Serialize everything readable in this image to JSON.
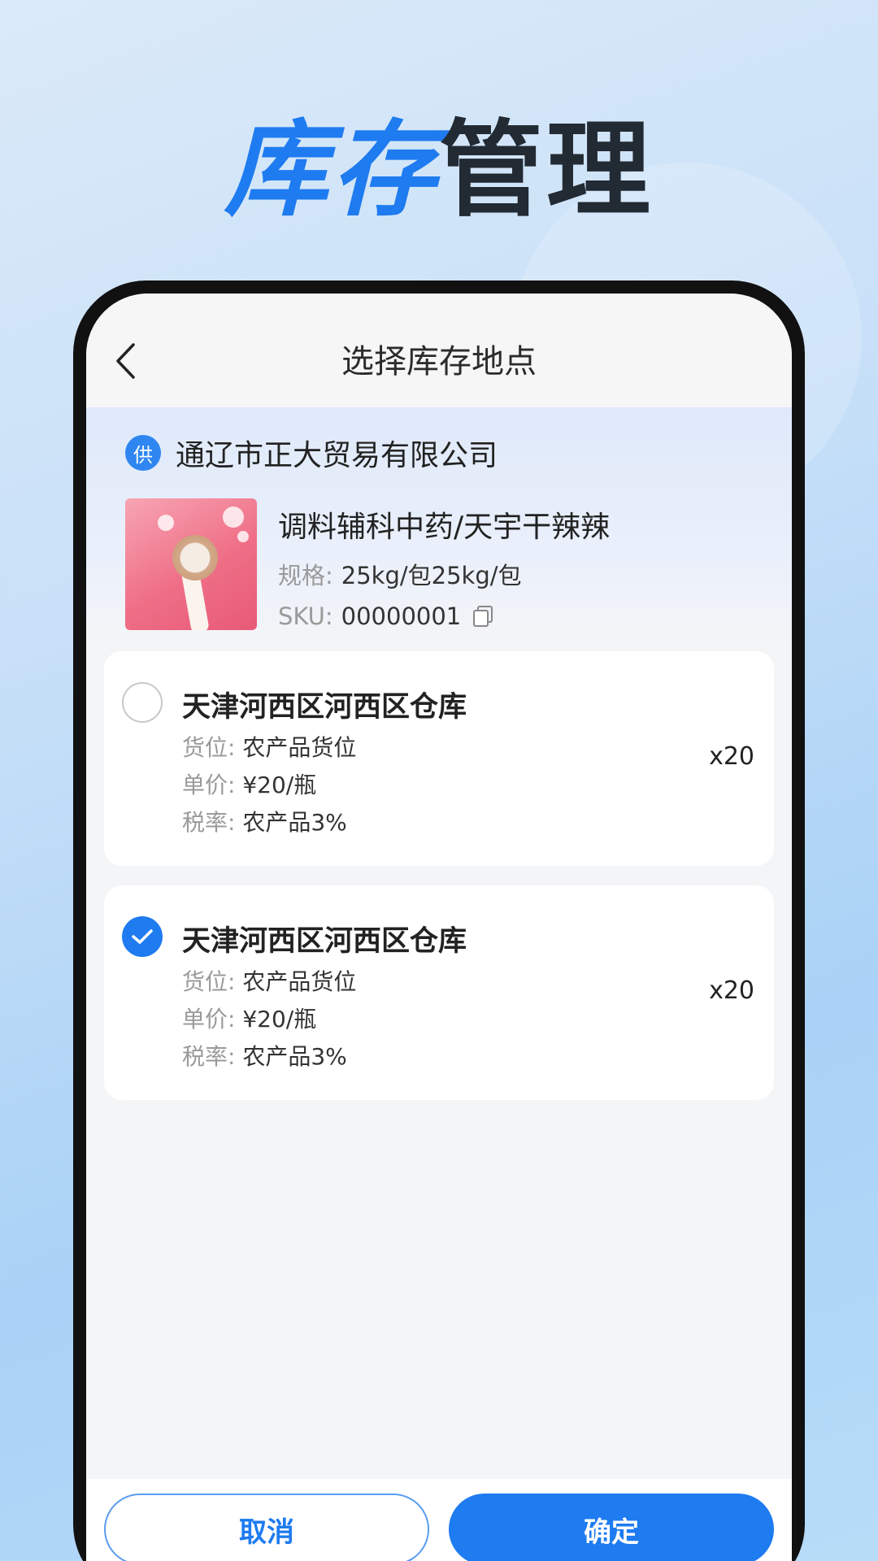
{
  "promo": {
    "title_blue": "库存",
    "title_dark": "管理"
  },
  "nav": {
    "title": "选择库存地点"
  },
  "supplier": {
    "badge": "供",
    "name": "通辽市正大贸易有限公司"
  },
  "product": {
    "name": "调料辅科中药/天宇干辣辣",
    "spec_label": "规格:",
    "spec_value": "25kg/包25kg/包",
    "sku_label": "SKU:",
    "sku_value": "00000001"
  },
  "warehouses": [
    {
      "name": "天津河西区河西区仓库",
      "location_label": "货位:",
      "location": "农产品货位",
      "price_label": "单价:",
      "price": "¥20/瓶",
      "tax_label": "税率:",
      "tax": "农产品3%",
      "qty": "x20",
      "selected": false
    },
    {
      "name": "天津河西区河西区仓库",
      "location_label": "货位:",
      "location": "农产品货位",
      "price_label": "单价:",
      "price": "¥20/瓶",
      "tax_label": "税率:",
      "tax": "农产品3%",
      "qty": "x20",
      "selected": true
    }
  ],
  "footer": {
    "cancel_label": "取消",
    "confirm_label": "确定"
  },
  "colors": {
    "accent": "#1e7bf0",
    "title_dark": "#222a33"
  }
}
